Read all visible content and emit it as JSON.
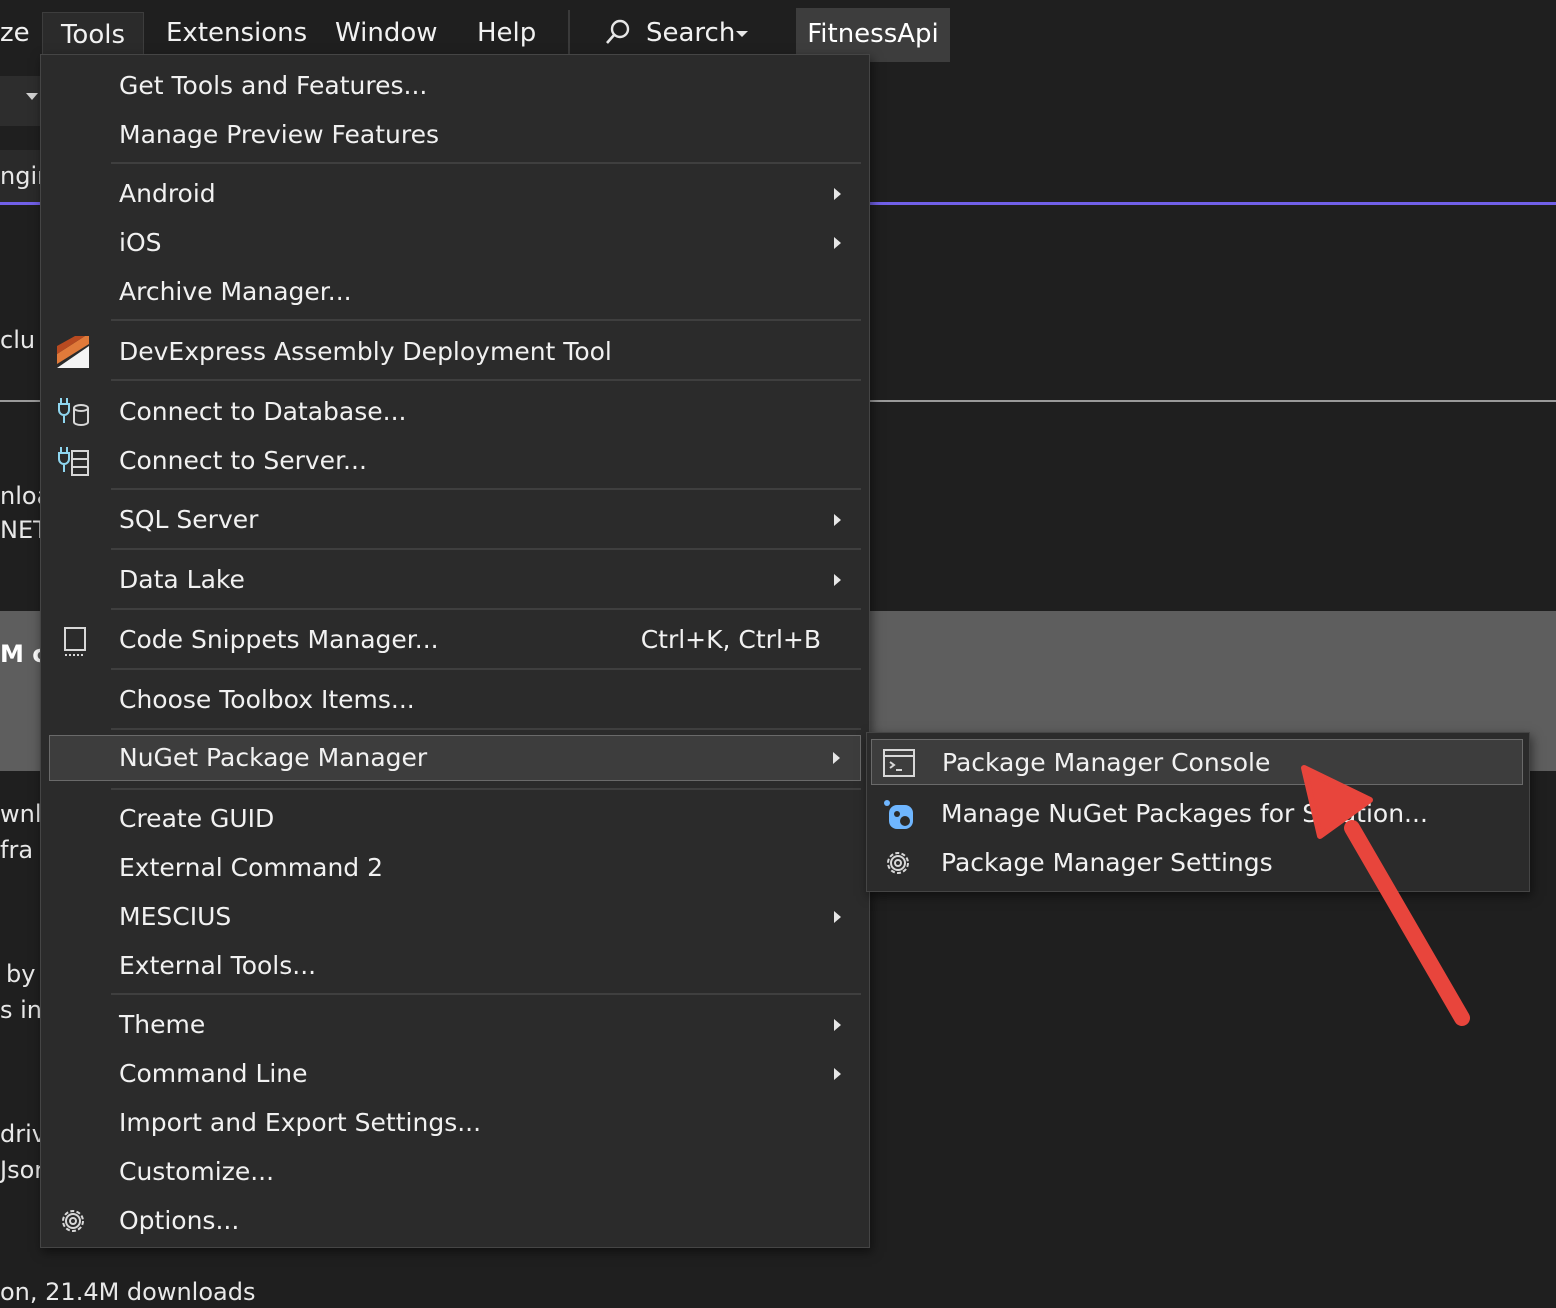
{
  "menubar": {
    "items": [
      {
        "label": "ze"
      },
      {
        "label": "Tools"
      },
      {
        "label": "Extensions"
      },
      {
        "label": "Window"
      },
      {
        "label": "Help"
      }
    ],
    "search_label": "Search",
    "project_name": "FitnessApi"
  },
  "background": {
    "fragments": [
      "ngir",
      "clu",
      "nloa",
      "NET",
      "M c",
      "wnlo",
      "fra",
      "by",
      "s inp",
      "driv",
      "Jsor"
    ],
    "footer_text": "on, 21.4M downloads"
  },
  "tools_menu": {
    "items": [
      {
        "label": "Get Tools and Features..."
      },
      {
        "label": "Manage Preview Features"
      },
      {
        "label": "Android"
      },
      {
        "label": "iOS"
      },
      {
        "label": "Archive Manager..."
      },
      {
        "label": "DevExpress Assembly Deployment Tool"
      },
      {
        "label": "Connect to Database..."
      },
      {
        "label": "Connect to Server..."
      },
      {
        "label": "SQL Server"
      },
      {
        "label": "Data Lake"
      },
      {
        "label": "Code Snippets Manager...",
        "shortcut": "Ctrl+K, Ctrl+B"
      },
      {
        "label": "Choose Toolbox Items..."
      },
      {
        "label": "NuGet Package Manager"
      },
      {
        "label": "Create GUID"
      },
      {
        "label": "External Command 2"
      },
      {
        "label": "MESCIUS"
      },
      {
        "label": "External Tools..."
      },
      {
        "label": "Theme"
      },
      {
        "label": "Command Line"
      },
      {
        "label": "Import and Export Settings..."
      },
      {
        "label": "Customize..."
      },
      {
        "label": "Options..."
      }
    ]
  },
  "nuget_submenu": {
    "items": [
      {
        "label": "Package Manager Console"
      },
      {
        "label": "Manage NuGet Packages for Solution..."
      },
      {
        "label": "Package Manager Settings"
      }
    ]
  },
  "colors": {
    "menu_bg": "#2b2b2b",
    "accent_line": "#7160e8",
    "annotation_arrow": "#e8453c"
  }
}
